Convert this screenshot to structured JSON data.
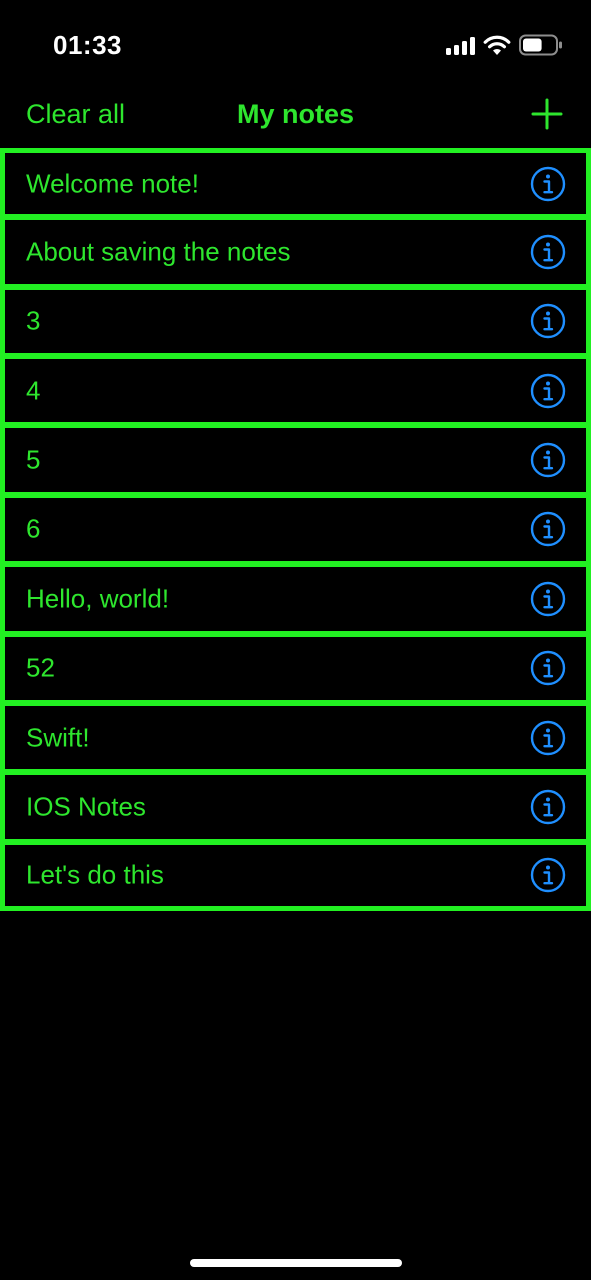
{
  "status_bar": {
    "time": "01:33",
    "icons": [
      "signal-icon",
      "wifi-icon",
      "battery-icon"
    ],
    "battery_level": 0.6
  },
  "nav": {
    "left_label": "Clear all",
    "title": "My notes",
    "right_icon": "plus-icon"
  },
  "notes": [
    {
      "title": "Welcome note!",
      "icon": "info-icon"
    },
    {
      "title": "About saving the notes",
      "icon": "info-icon"
    },
    {
      "title": "3",
      "icon": "info-icon"
    },
    {
      "title": "4",
      "icon": "info-icon"
    },
    {
      "title": "5",
      "icon": "info-icon"
    },
    {
      "title": "6",
      "icon": "info-icon"
    },
    {
      "title": "Hello, world!",
      "icon": "info-icon"
    },
    {
      "title": "52",
      "icon": "info-icon"
    },
    {
      "title": "Swift!",
      "icon": "info-icon"
    },
    {
      "title": "IOS Notes",
      "icon": "info-icon"
    },
    {
      "title": "Let's do this",
      "icon": "info-icon"
    }
  ],
  "colors": {
    "background": "#000000",
    "accent": "#2ee62e",
    "row_border": "#22f022",
    "info_icon": "#1f8fff",
    "status_text": "#ffffff"
  }
}
